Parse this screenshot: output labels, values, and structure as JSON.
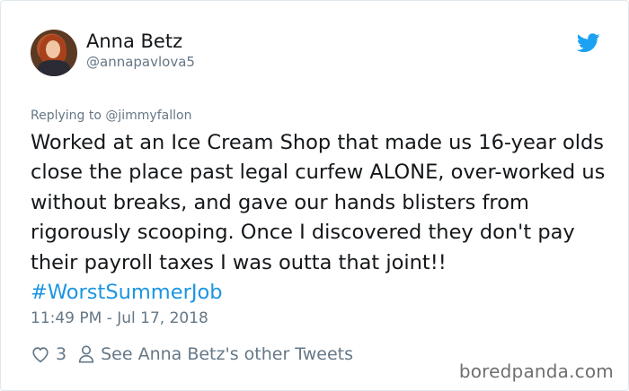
{
  "author": {
    "name": "Anna Betz",
    "handle": "@annapavlova5"
  },
  "tweet": {
    "replying_to": "Replying to @jimmyfallon",
    "text": "Worked at an Ice Cream Shop that made us 16-year olds close the place past legal curfew ALONE, over-worked us without breaks, and gave our hands blisters from rigorously scooping. Once I discovered they don't pay their payroll taxes I was outta that joint!! ",
    "hashtag": "#WorstSummerJob",
    "timestamp": "11:49 PM - Jul 17, 2018"
  },
  "actions": {
    "like_count": "3",
    "other_tweets_label": "See Anna Betz's other Tweets"
  },
  "icons": {
    "logo": "twitter-bird-icon",
    "like": "heart-icon",
    "profile": "person-icon"
  },
  "colors": {
    "twitter_blue": "#1da1f2",
    "hashtag": "#1b95e0",
    "secondary_text": "#657786"
  },
  "watermark": "boredpanda.com"
}
